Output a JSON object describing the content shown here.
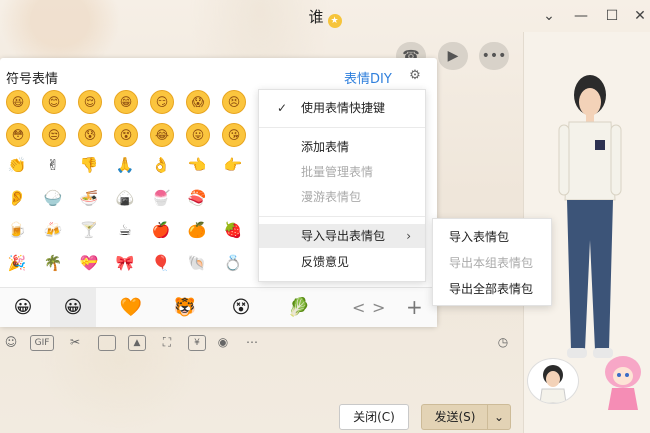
{
  "window": {
    "title": "谁",
    "controls": [
      "chevron-down-icon",
      "minimize-icon",
      "maximize-icon",
      "close-icon"
    ]
  },
  "chat_actions": [
    "phone-icon",
    "video-icon",
    "more-icon"
  ],
  "emoji_panel": {
    "title": "符号表情",
    "diy_label": "表情DIY",
    "rows": [
      [
        "😆",
        "😊",
        "😌",
        "😁",
        "😏",
        "😱",
        "😣"
      ],
      [
        "😳",
        "😒",
        "😰",
        "😵",
        "😂",
        "😛",
        "😘"
      ],
      [
        "👏",
        "✌",
        "👎",
        "🙏",
        "👌",
        "👈",
        "👉"
      ],
      [
        "👂",
        "🍚",
        "🍜",
        "🍙",
        "🍧",
        "🍣"
      ],
      [
        "🍺",
        "🍻",
        "🍸",
        "☕",
        "🍎",
        "🍊",
        "🍓"
      ],
      [
        "🎉",
        "🌴",
        "💝",
        "🎀",
        "🎈",
        "🐚",
        "💍"
      ]
    ],
    "tabs": [
      "😀",
      "😀",
      "🧡",
      "🐯",
      "😵",
      "🥬"
    ],
    "nav_prev": "<",
    "nav_next": ">",
    "add": "+"
  },
  "context_menu": {
    "items": [
      {
        "label": "使用表情快捷键",
        "checked": true,
        "disabled": false
      },
      {
        "label": "添加表情",
        "disabled": false
      },
      {
        "label": "批量管理表情",
        "disabled": true
      },
      {
        "label": "漫游表情包",
        "disabled": true
      },
      {
        "label": "导入导出表情包",
        "disabled": false,
        "submenu": true,
        "hovered": true
      },
      {
        "label": "反馈意见",
        "disabled": false
      }
    ]
  },
  "submenu": {
    "items": [
      {
        "label": "导入表情包",
        "disabled": false
      },
      {
        "label": "导出本组表情包",
        "disabled": true
      },
      {
        "label": "导出全部表情包",
        "disabled": false
      }
    ]
  },
  "toolbar": {
    "icons": [
      "smiley-icon",
      "gif-icon",
      "scissors-icon",
      "folder-icon",
      "image-icon",
      "screenshot-icon",
      "red-packet-icon",
      "voice-icon",
      "more-dots-icon",
      "history-clock-icon"
    ],
    "gif_label": "GIF"
  },
  "buttons": {
    "close": "关闭(C)",
    "send": "发送(S)",
    "send_arrow": "⌄"
  }
}
